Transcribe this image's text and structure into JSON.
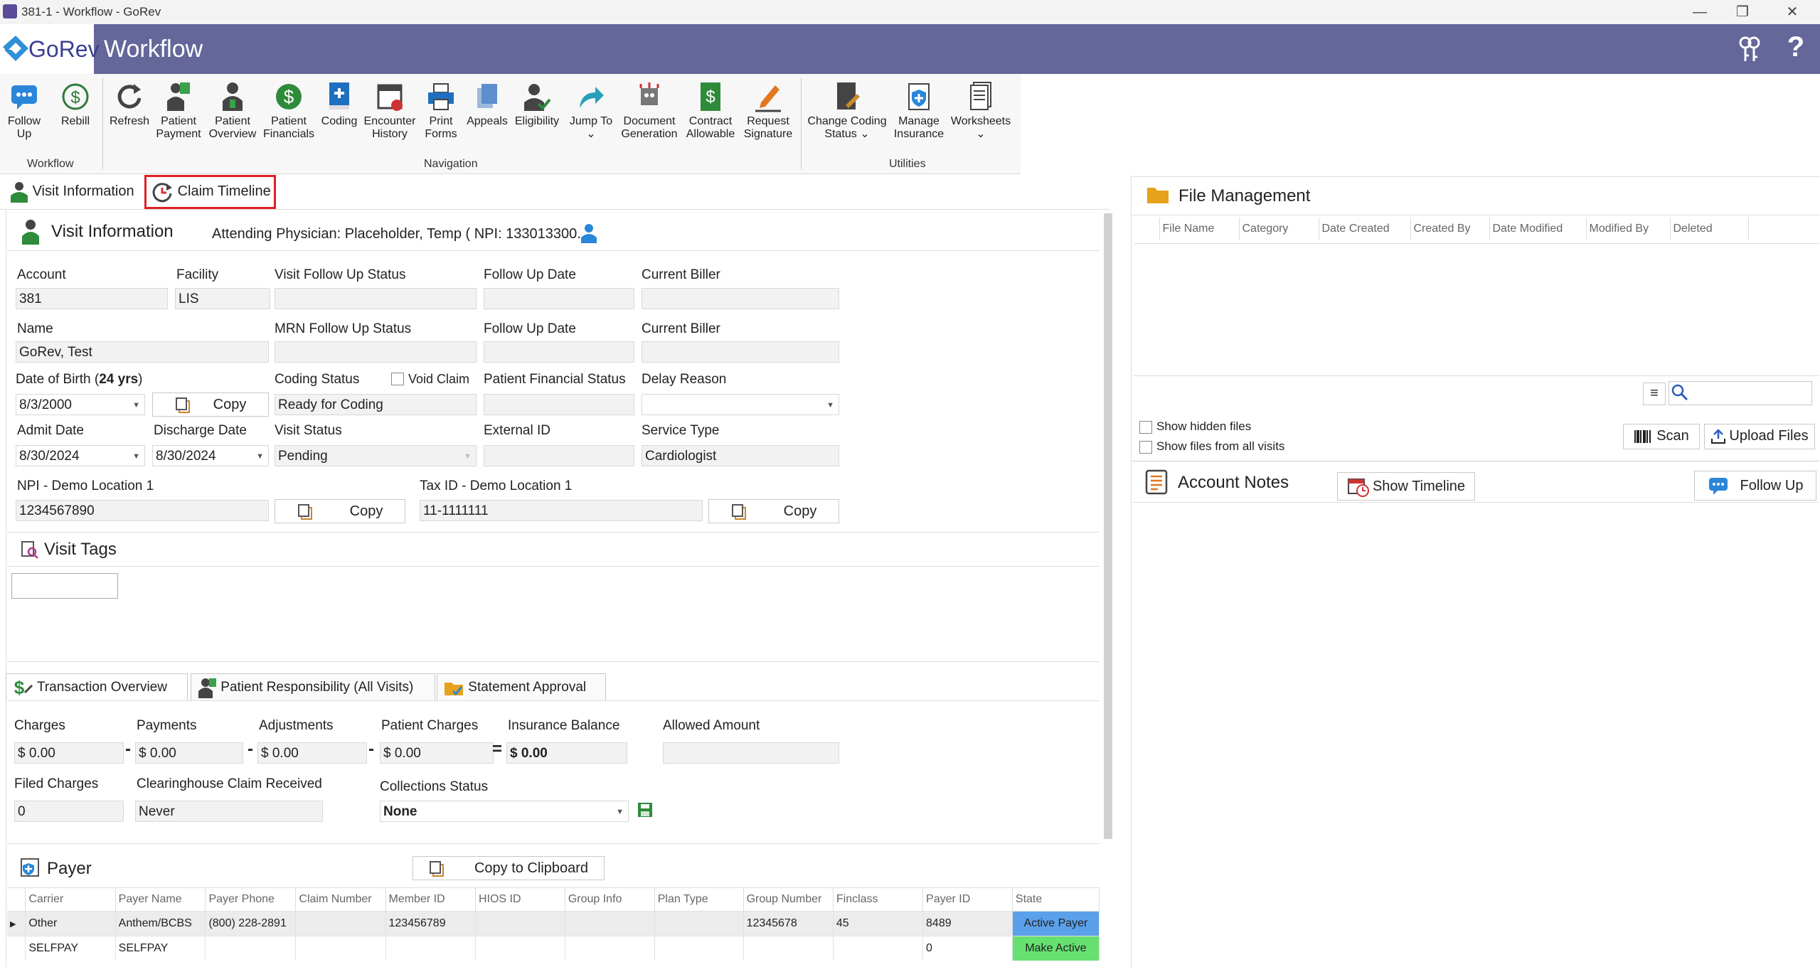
{
  "window": {
    "title": "381-1 - Workflow - GoRev",
    "minimize": "—",
    "restore": "❐",
    "close": "✕"
  },
  "header": {
    "brand": "GoRev",
    "title": "Workflow"
  },
  "ribbon": {
    "groups": {
      "workflow": "Workflow",
      "navigation": "Navigation",
      "utilities": "Utilities"
    },
    "buttons": [
      {
        "l1": "Follow",
        "l2": "Up"
      },
      {
        "l1": "Rebill",
        "l2": ""
      },
      {
        "l1": "Refresh",
        "l2": ""
      },
      {
        "l1": "Patient",
        "l2": "Payment"
      },
      {
        "l1": "Patient",
        "l2": "Overview"
      },
      {
        "l1": "Patient",
        "l2": "Financials"
      },
      {
        "l1": "Coding",
        "l2": ""
      },
      {
        "l1": "Encounter",
        "l2": "History"
      },
      {
        "l1": "Print",
        "l2": "Forms"
      },
      {
        "l1": "Appeals",
        "l2": ""
      },
      {
        "l1": "Eligibility",
        "l2": ""
      },
      {
        "l1": "Jump To",
        "l2": "⌄"
      },
      {
        "l1": "Document",
        "l2": "Generation"
      },
      {
        "l1": "Contract",
        "l2": "Allowable"
      },
      {
        "l1": "Request",
        "l2": "Signature"
      },
      {
        "l1": "Change Coding",
        "l2": "Status ⌄"
      },
      {
        "l1": "Manage",
        "l2": "Insurance"
      },
      {
        "l1": "Worksheets",
        "l2": "⌄"
      }
    ]
  },
  "tabs": {
    "visit_info": "Visit Information",
    "claim_timeline": "Claim Timeline"
  },
  "visit": {
    "title": "Visit Information",
    "physician": "Attending Physician: Placeholder, Temp ( NPI: 133013300...",
    "labels": {
      "account": "Account",
      "facility": "Facility",
      "visit_fu_status": "Visit Follow Up Status",
      "fu_date": "Follow Up Date",
      "current_biller": "Current Biller",
      "name": "Name",
      "mrn_fu_status": "MRN Follow Up Status",
      "dob": "Date of Birth (",
      "age": "24 yrs",
      "dob_close": ")",
      "coding_status": "Coding Status",
      "void_claim": "Void Claim",
      "pfs": "Patient Financial Status",
      "delay_reason": "Delay Reason",
      "admit": "Admit Date",
      "discharge": "Discharge Date",
      "visit_status": "Visit Status",
      "external_id": "External ID",
      "service_type": "Service Type",
      "npi": "NPI - Demo Location 1",
      "tax": "Tax ID - Demo Location 1"
    },
    "values": {
      "account": "381",
      "facility": "LIS",
      "name": "GoRev, Test",
      "dob": "8/3/2000",
      "coding_status": "Ready for Coding",
      "admit": "8/30/2024",
      "discharge": "8/30/2024",
      "visit_status": "Pending",
      "service_type": "Cardiologist",
      "npi": "1234567890",
      "tax": "11-1111111"
    },
    "copy": "Copy"
  },
  "tags": {
    "title": "Visit Tags"
  },
  "transactions": {
    "tabs": [
      "Transaction Overview",
      "Patient Responsibility (All Visits)",
      "Statement Approval"
    ],
    "labels": {
      "charges": "Charges",
      "payments": "Payments",
      "adjustments": "Adjustments",
      "patient_charges": "Patient Charges",
      "ins_balance": "Insurance Balance",
      "allowed": "Allowed Amount",
      "filed": "Filed Charges",
      "clearinghouse": "Clearinghouse Claim Received",
      "collections": "Collections Status"
    },
    "values": {
      "charges": "$ 0.00",
      "payments": "$ 0.00",
      "adjustments": "$ 0.00",
      "patient_charges": "$ 0.00",
      "ins_balance": "$ 0.00",
      "filed": "0",
      "clearinghouse": "Never",
      "collections": "None"
    },
    "ops": {
      "minus": "-",
      "equals": "="
    }
  },
  "payer": {
    "title": "Payer",
    "copy_clipboard": "Copy to Clipboard",
    "columns": [
      "Carrier",
      "Payer Name",
      "Payer Phone",
      "Claim Number",
      "Member ID",
      "HIOS ID",
      "Group Info",
      "Plan Type",
      "Group Number",
      "Finclass",
      "Payer ID",
      "State"
    ],
    "rows": [
      [
        "Other",
        "Anthem/BCBS",
        "(800) 228-2891",
        "",
        "123456789",
        "",
        "",
        "",
        "12345678",
        "45",
        "8489",
        "Active Payer"
      ],
      [
        "SELFPAY",
        "SELFPAY",
        "",
        "",
        "",
        "",
        "",
        "",
        "",
        "",
        "0",
        "Make Active"
      ]
    ],
    "state_colors": [
      "#5aa0ea",
      "#66e070"
    ]
  },
  "files": {
    "title": "File Management",
    "columns": [
      "File Name",
      "Category",
      "Date Created",
      "Created By",
      "Date Modified",
      "Modified By",
      "Deleted"
    ],
    "show_hidden": "Show hidden files",
    "show_all": "Show files from all visits",
    "scan": "Scan",
    "upload": "Upload Files"
  },
  "notes": {
    "title": "Account Notes",
    "show_timeline": "Show Timeline",
    "follow_up": "Follow Up"
  },
  "colors": {
    "header": "#65669a",
    "highlight": "#e01f26"
  }
}
